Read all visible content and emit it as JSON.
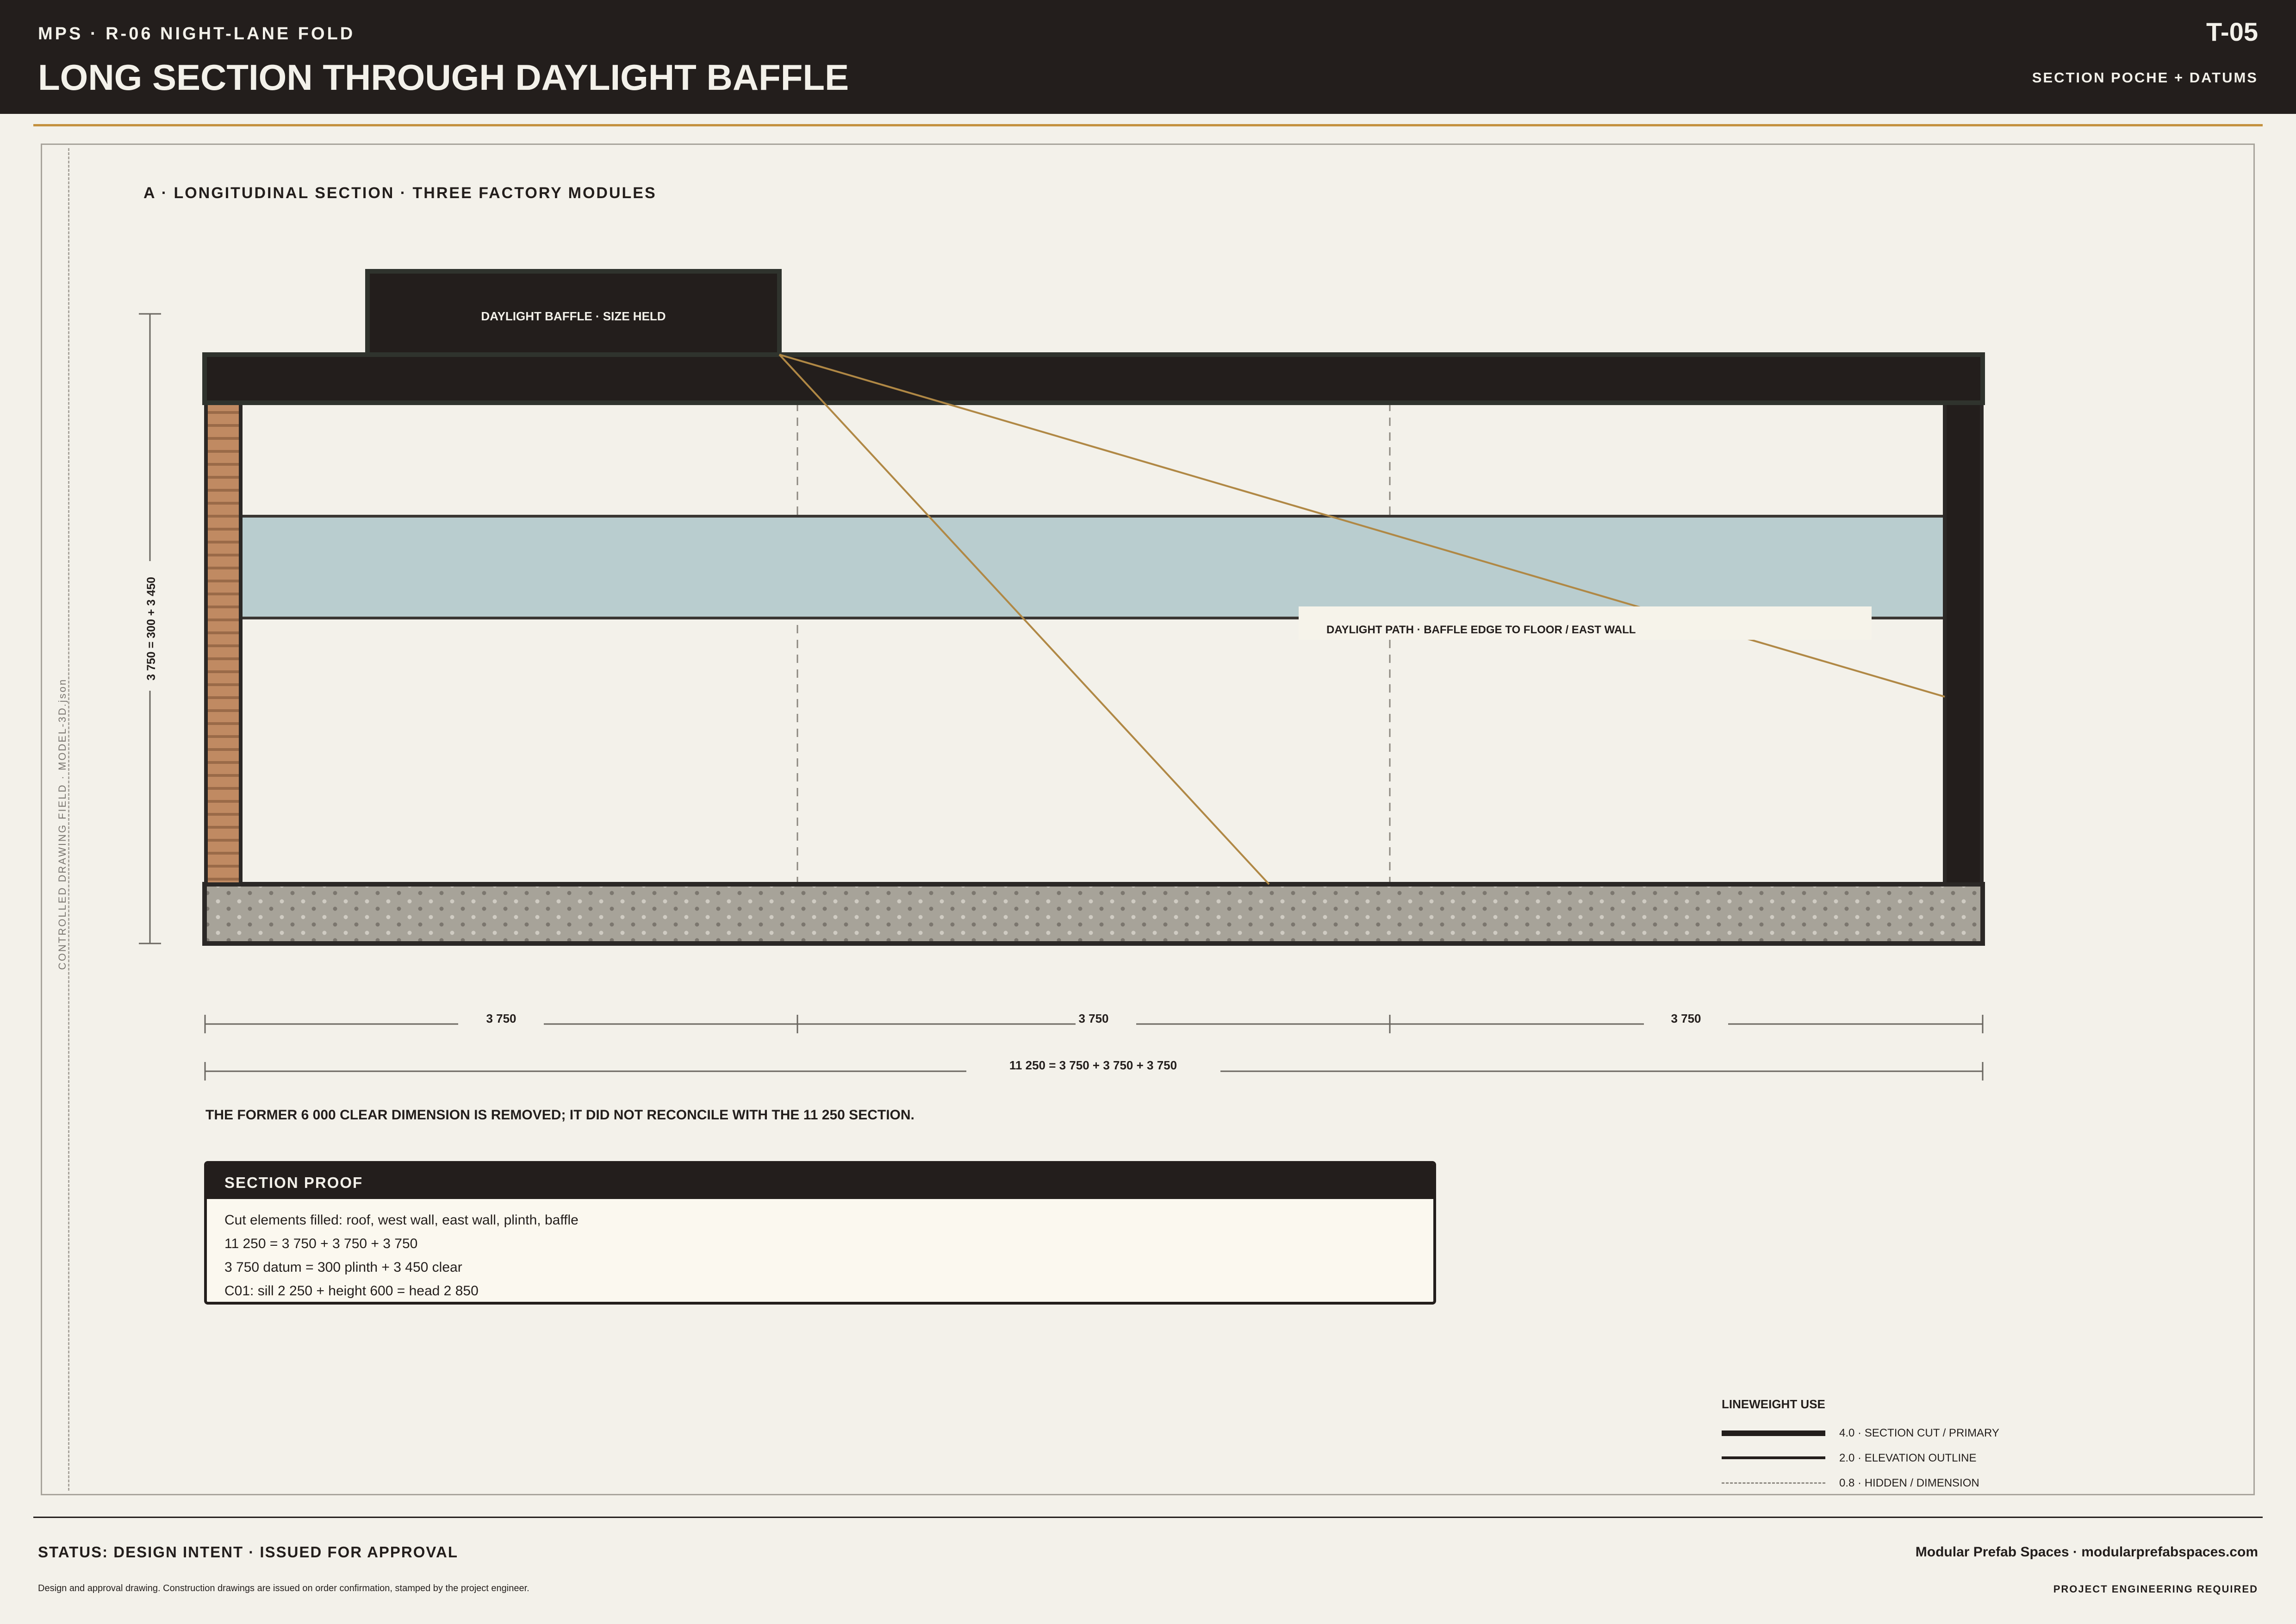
{
  "header": {
    "kicker": "MPS · R-06 NIGHT-LANE FOLD",
    "title": "LONG SECTION THROUGH DAYLIGHT BAFFLE",
    "sheet_code": "T-05",
    "subtitle": "SECTION POCHE + DATUMS"
  },
  "frame": {
    "side_label": "CONTROLLED DRAWING FIELD · MODEL-3D.json"
  },
  "view": {
    "title": "A · LONGITUDINAL SECTION · THREE FACTORY MODULES",
    "baffle_label": "DAYLIGHT BAFFLE · SIZE HELD",
    "daylight_path_label": "DAYLIGHT PATH · BAFFLE EDGE TO FLOOR / EAST WALL",
    "height_dimension": "3 750 = 300 + 3 450",
    "module_dimensions": [
      "3 750",
      "3 750",
      "3 750"
    ],
    "overall_dimension": "11 250 = 3 750 + 3 750 + 3 750"
  },
  "note": "THE FORMER 6 000 CLEAR DIMENSION IS REMOVED; IT DID NOT RECONCILE WITH THE 11 250 SECTION.",
  "proof": {
    "title": "SECTION PROOF",
    "lines": [
      "Cut elements filled: roof, west wall, east wall, plinth, baffle",
      "11 250 = 3 750 + 3 750 + 3 750",
      "3 750 datum = 300 plinth + 3 450 clear",
      "C01: sill 2 250 + height 600 = head 2 850"
    ]
  },
  "legend": {
    "title": "LINEWEIGHT USE",
    "items": [
      {
        "label": "4.0 · SECTION CUT / PRIMARY"
      },
      {
        "label": "2.0 · ELEVATION OUTLINE"
      },
      {
        "label": "0.8 · HIDDEN / DIMENSION"
      }
    ]
  },
  "footer": {
    "status": "STATUS: DESIGN INTENT · ISSUED FOR APPROVAL",
    "disclaimer": "Design and approval drawing. Construction drawings are issued on order confirmation, stamped by the project engineer.",
    "company": "Modular Prefab Spaces · modularprefabspaces.com",
    "engineering": "PROJECT ENGINEERING REQUIRED"
  },
  "colors": {
    "ink": "#231e1c",
    "paper": "#f3f1ea",
    "accent": "#c4913f",
    "glazing": "#b9cdcf",
    "timber": "#c08a62",
    "concrete": "#a7a399"
  }
}
